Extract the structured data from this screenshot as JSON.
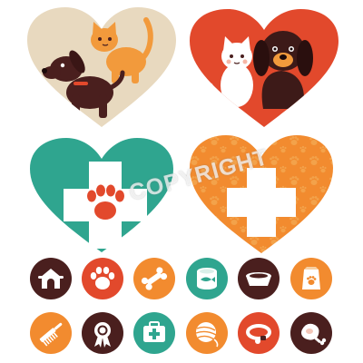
{
  "colors": {
    "beige": "#e8d9bf",
    "red_orange": "#e2492c",
    "teal": "#2fa58f",
    "orange": "#f28b2f",
    "dark_brown": "#4a1f1e",
    "white": "#ffffff",
    "paw_orange": "#f3a24a"
  },
  "hearts": [
    {
      "name": "heart-beige-cat-dog",
      "color": "beige",
      "content": "orange-cat-and-brown-dog"
    },
    {
      "name": "heart-red-cat-dog",
      "color": "red_orange",
      "content": "white-cat-and-dark-dog"
    },
    {
      "name": "heart-teal-vet-cross-paw",
      "color": "teal",
      "content": "white-cross-with-paw"
    },
    {
      "name": "heart-orange-pattern-cross",
      "color": "orange",
      "content": "white-cross-on-paw-pattern"
    }
  ],
  "icons_row1": [
    {
      "name": "doghouse-icon",
      "bg": "dark_brown"
    },
    {
      "name": "paw-print-icon",
      "bg": "red_orange"
    },
    {
      "name": "bone-icon",
      "bg": "orange"
    },
    {
      "name": "pet-food-can-icon",
      "bg": "teal"
    },
    {
      "name": "pet-bowl-icon",
      "bg": "dark_brown"
    },
    {
      "name": "pet-food-bag-icon",
      "bg": "orange"
    }
  ],
  "icons_row2": [
    {
      "name": "grooming-comb-icon",
      "bg": "orange"
    },
    {
      "name": "award-ribbon-icon",
      "bg": "dark_brown"
    },
    {
      "name": "first-aid-kit-icon",
      "bg": "teal"
    },
    {
      "name": "yarn-ball-icon",
      "bg": "orange"
    },
    {
      "name": "pet-collar-icon",
      "bg": "red_orange"
    },
    {
      "name": "ham-meat-icon",
      "bg": "dark_brown"
    }
  ],
  "watermark": {
    "text": "COPYRIGHT"
  }
}
